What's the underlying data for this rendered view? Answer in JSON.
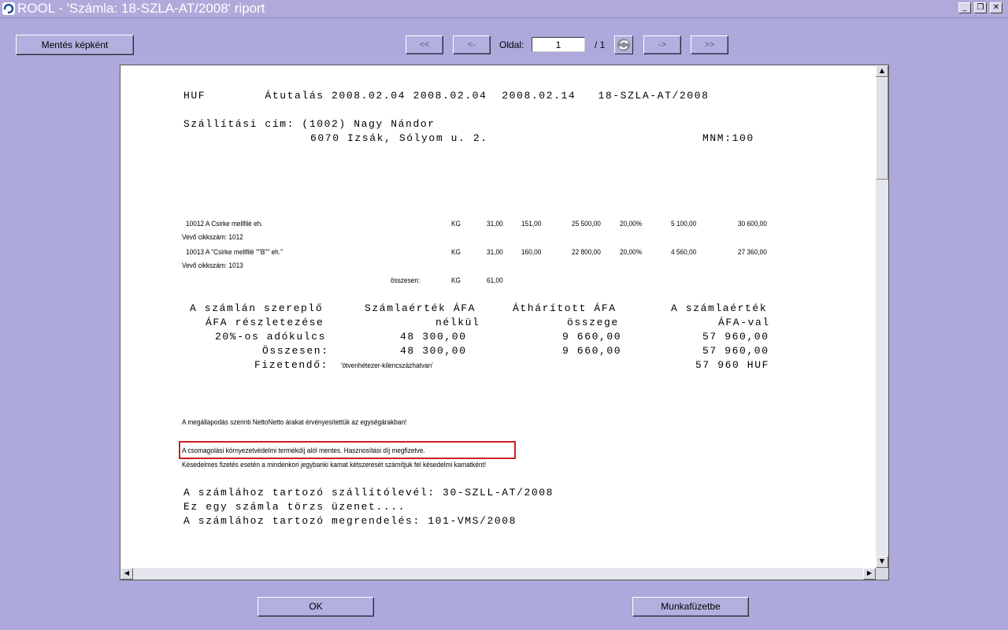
{
  "window": {
    "title": "ROOL  -  'Számla: 18-SZLA-AT/2008' riport",
    "minimize": "_",
    "restore": "❐",
    "close": "✕"
  },
  "toolbar": {
    "save_image": "Mentés képként",
    "first": "<<",
    "prev": "<-",
    "page_label": "Oldal:",
    "page_value": "1",
    "page_total": "/ 1",
    "refresh_icon": "refresh-icon",
    "next": "->",
    "last": ">>"
  },
  "report": {
    "header_line": "HUF        Átutalás 2008.02.04 2008.02.04  2008.02.14   18-SZLA-AT/2008",
    "ship_line1": "Szállítási cím: (1002) Nagy Nándor",
    "ship_line2": "6070 Izsák, Sólyom u. 2.",
    "mnm": "MNM:100",
    "items": [
      {
        "code_desc": "10012 A Csirke mellfilé eh.",
        "unit": "KG",
        "qty": "31,00",
        "price": "151,00",
        "net": "25 500,00",
        "vat": "20,00%",
        "vat_amount": "5 100,00",
        "gross": "30 600,00",
        "buyer_code": "Vevő cikkszám: 1012"
      },
      {
        "code_desc": "10013 A \"Csirke mellfilé \"\"B\"\" eh.\"",
        "unit": "KG",
        "qty": "31,00",
        "price": "160,00",
        "net": "22 800,00",
        "vat": "20,00%",
        "vat_amount": "4 560,00",
        "gross": "27 360,00",
        "buyer_code": "Vevő cikkszám: 1013"
      }
    ],
    "sum_label": "összesen:",
    "sum_unit": "KG",
    "sum_qty": "61,00",
    "vat_table": {
      "h1": "A számlán szereplő",
      "h1b": "ÁFA részletezése",
      "h2": "Számlaérték ÁFA",
      "h2b": "nélkül",
      "h3": "Áthárított ÁFA",
      "h3b": "összege",
      "h4": "A számlaérték",
      "h4b": "ÁFA-val",
      "row1_label": "20%-os adókulcs",
      "row1_net": "48 300,00",
      "row1_vat": "9 660,00",
      "row1_gross": "57 960,00",
      "row2_label": "Összesen:",
      "row2_net": "48 300,00",
      "row2_vat": "9 660,00",
      "row2_gross": "57 960,00",
      "payable_label": "Fizetendő:",
      "payable_words": "'ötvenhétezer-kilencszázhatvan'",
      "payable_amount": "57 960 HUF"
    },
    "note1": "A megállapodás szerinti NettoNetto árakat érvényesítettük az egységárakban!",
    "note2": "A csomagolási környezetvédelmi termékdíj alól mentes. Hasznosítási díj megfizetve.",
    "note3": "Késedelmes fizetés esetén a mindenkori jegybanki kamat kétszeresét számítjuk fel késedelmi kamatként!",
    "footer1": "A számlához tartozó szállítólevél: 30-SZLL-AT/2008",
    "footer2": "Ez egy számla törzs üzenet....",
    "footer3": "A számlához tartozó megrendelés: 101-VMS/2008"
  },
  "bottom": {
    "ok": "OK",
    "workbook": "Munkafüzetbe"
  }
}
